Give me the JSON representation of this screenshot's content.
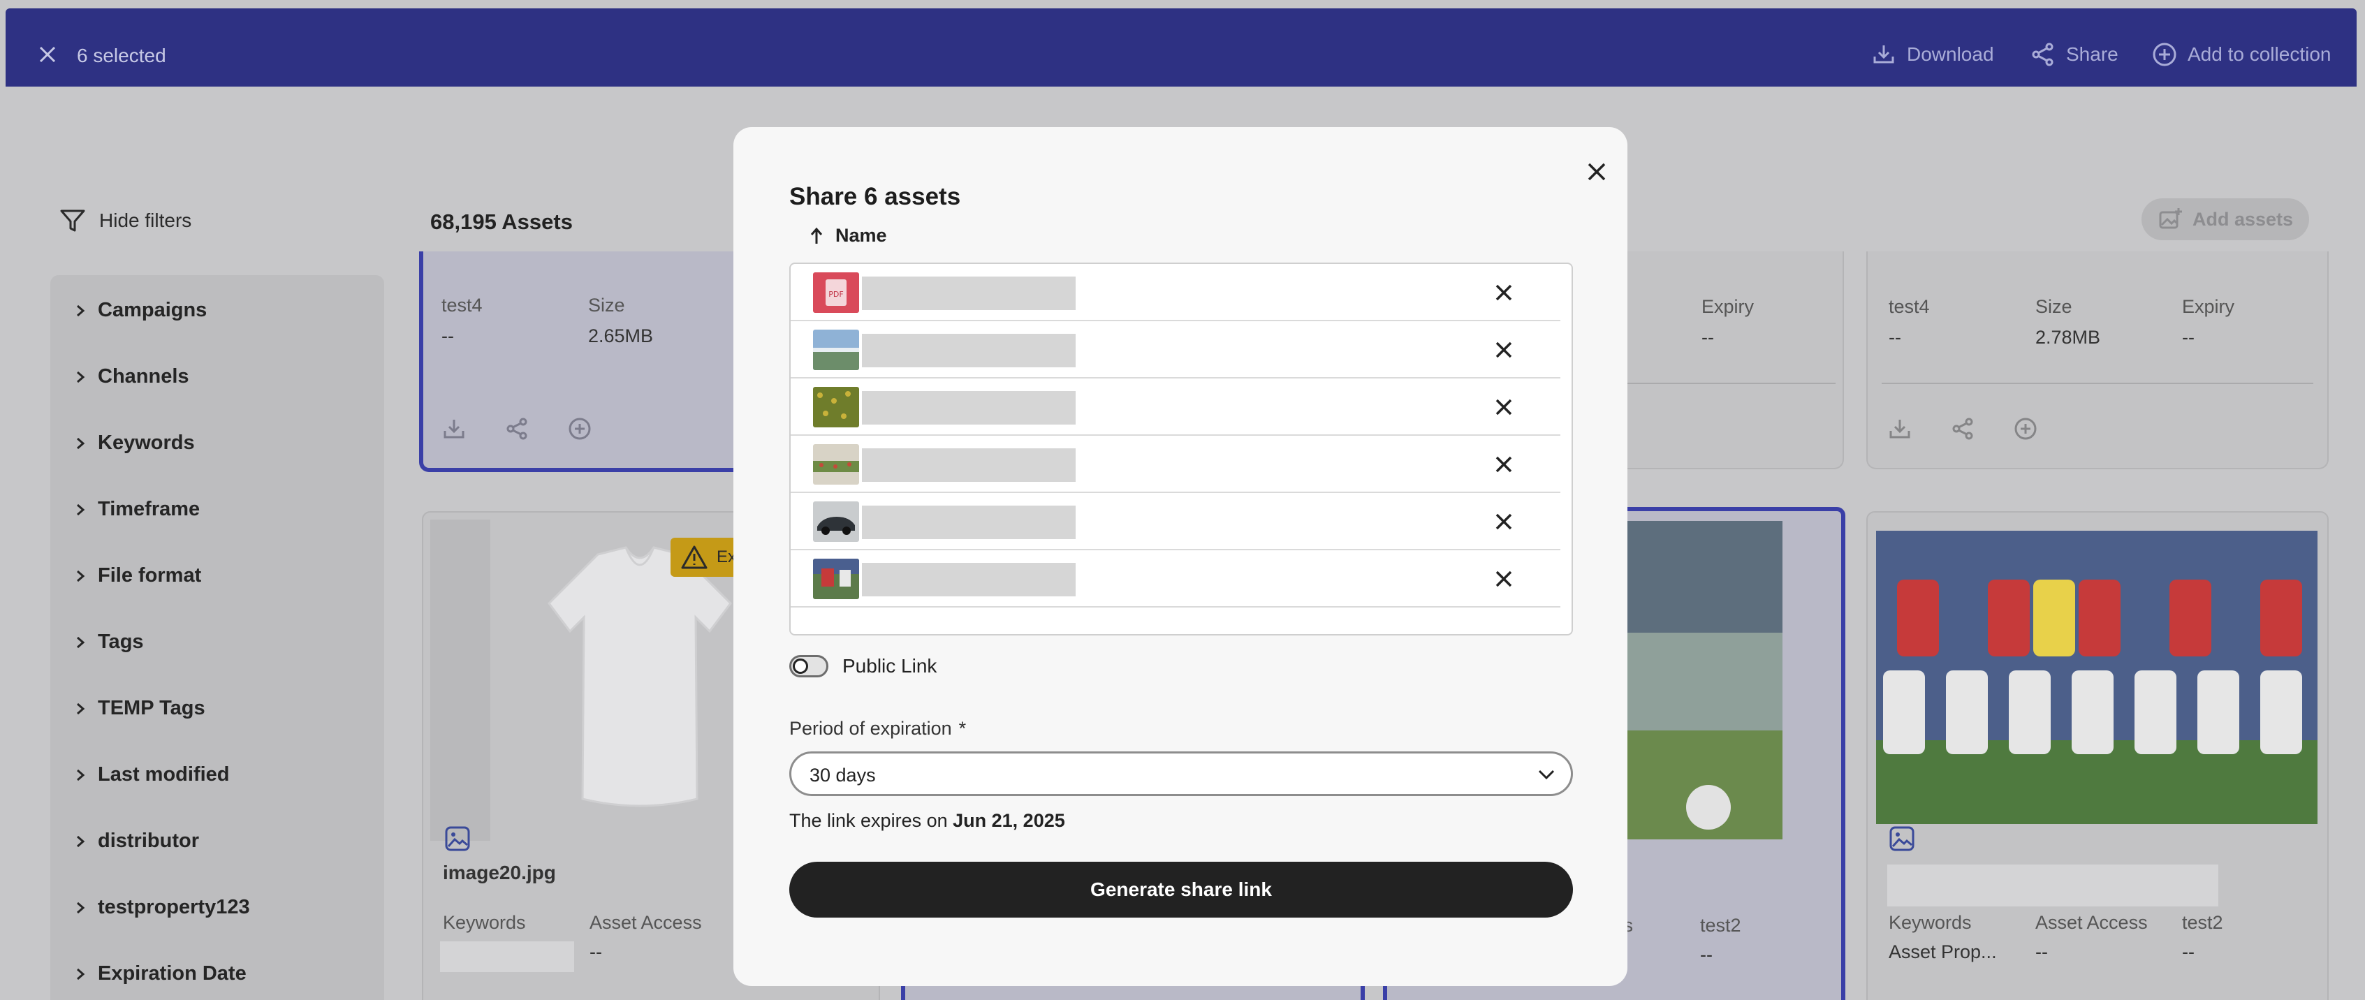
{
  "topbar": {
    "selected_label": "6 selected",
    "download_label": "Download",
    "share_label": "Share",
    "add_to_collection_label": "Add to collection"
  },
  "page": {
    "hide_filters_label": "Hide filters",
    "assets_count": "68,195 Assets",
    "add_assets_label": "Add assets"
  },
  "filters": [
    "Campaigns",
    "Channels",
    "Keywords",
    "Timeframe",
    "File format",
    "Tags",
    "TEMP Tags",
    "Last modified",
    "distributor",
    "testproperty123",
    "Expiration Date"
  ],
  "cards": {
    "c1": {
      "title": "test4",
      "title_val": "--",
      "size_lbl": "Size",
      "size_val": "2.65MB"
    },
    "c2": {
      "expiry_lbl": "Expiry",
      "expiry_val": "--"
    },
    "c3": {
      "title": "test4",
      "title_val": "--",
      "size_lbl": "Size",
      "size_val": "2.78MB",
      "expiry_lbl": "Expiry",
      "expiry_val": "--"
    },
    "c4": {
      "filename": "image20.jpg",
      "badge": "Ex",
      "kw_lbl": "Keywords",
      "access_lbl": "Asset Access",
      "access_val": "--"
    },
    "c5": {
      "col1_lbl": "ess",
      "col2_lbl": "test2",
      "col2_val": "--"
    },
    "c6": {
      "kw_lbl": "Keywords",
      "kw_val": "Asset Prop...",
      "access_lbl": "Asset Access",
      "access_val": "--",
      "col3_lbl": "test2",
      "col3_val": "--"
    }
  },
  "modal": {
    "title": "Share 6 assets",
    "sort_label": "Name",
    "public_link_label": "Public Link",
    "expiration_label": "Period of expiration",
    "required_mark": "*",
    "expiration_value": "30 days",
    "expires_prefix": "The link expires on",
    "expires_date": "Jun 21, 2025",
    "generate_label": "Generate share link"
  },
  "colors": {
    "topbar": "#2e3183",
    "selected_border": "#3a3fa7",
    "primary_button": "#222222",
    "warning_badge": "#c59a17"
  }
}
